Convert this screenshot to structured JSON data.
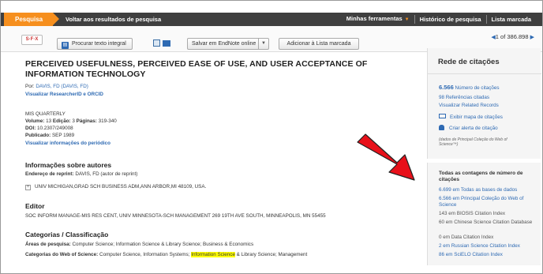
{
  "topbar": {
    "active_tab": "Pesquisa",
    "back_link": "Voltar aos resultados de pesquisa",
    "my_tools": "Minhas ferramentas",
    "search_history": "Histórico de pesquisa",
    "marked_list": "Lista marcada"
  },
  "toolbar": {
    "sfx_label": "S·F·X",
    "full_text_label": "Procurar texto integral",
    "endnote_label": "Salvar em EndNote online",
    "add_marked_label": "Adicionar à Lista marcada",
    "pager_current": "1",
    "pager_of": "of",
    "pager_total": "386.898"
  },
  "article": {
    "title": "PERCEIVED USEFULNESS, PERCEIVED EASE OF USE, AND USER ACCEPTANCE OF INFORMATION TECHNOLOGY",
    "by_label": "Por:",
    "author": "DAVIS, FD (DAVIS, FD)",
    "researcher_link": "Visualizar ResearcherID e ORCID",
    "journal": "MIS QUARTERLY",
    "volume_label": "Volume:",
    "volume": "13",
    "issue_label": "Edição:",
    "issue": "3",
    "pages_label": "Páginas:",
    "pages": "319-340",
    "doi_label": "DOI:",
    "doi": "10.2307/249008",
    "published_label": "Publicado:",
    "published": "SEP 1989",
    "journal_info_link": "Visualizar informações do periódico",
    "author_info_heading": "Informações sobre autores",
    "reprint_label": "Endereço de reprint:",
    "reprint_value": "DAVIS, FD (autor de reprint)",
    "reprint_address": "UNIV MICHIGAN,GRAD SCH BUSINESS ADM,ANN ARBOR,MI 48109, USA.",
    "editor_heading": "Editor",
    "editor_value": "SOC INFORM MANAGE-MIS RES CENT, UNIV MINNESOTA-SCH MANAGEMENT 269 19TH AVE SOUTH, MINNEAPOLIS, MN 55455",
    "categories_heading": "Categorias / Classificação",
    "research_areas_label": "Áreas de pesquisa:",
    "research_areas_value": "Computer Science; Information Science & Library Science; Business & Economics",
    "wos_categories_label": "Categorias do Web of Science:",
    "wos_categories_pre": "Computer Science, Information Systems;",
    "wos_categories_highlight": "Information Science",
    "wos_categories_post": "& Library Science; Management"
  },
  "sidebar": {
    "citation_network_heading": "Rede de citações",
    "citation_count": "6.566",
    "citation_count_label": "Número de citações",
    "cited_references": "98 Referências citadas",
    "related_records": "Visualizar Related Records",
    "show_map": "Exibir mapa de citações",
    "create_alert": "Criar alerta de citação",
    "data_note": "(dados de Principal Coleção do Web of Science™)",
    "all_counts_heading": "Todas as contagens de número de citações",
    "counts": [
      "6.699 em Todas as bases de dados",
      "6.566 em Principal Coleção do Web of Science",
      "143 em BIOSIS Citation Index",
      "60 em Chinese Science Citation Database",
      "0 em Data Citation Index",
      "2 em Russian Science Citation Index",
      "86 em SciELO Citation Index"
    ]
  },
  "colors": {
    "accent_orange": "#f68f1e",
    "link_blue": "#2e6ab3",
    "highlight_yellow": "#ffff00",
    "arrow_red": "#e8101a"
  }
}
